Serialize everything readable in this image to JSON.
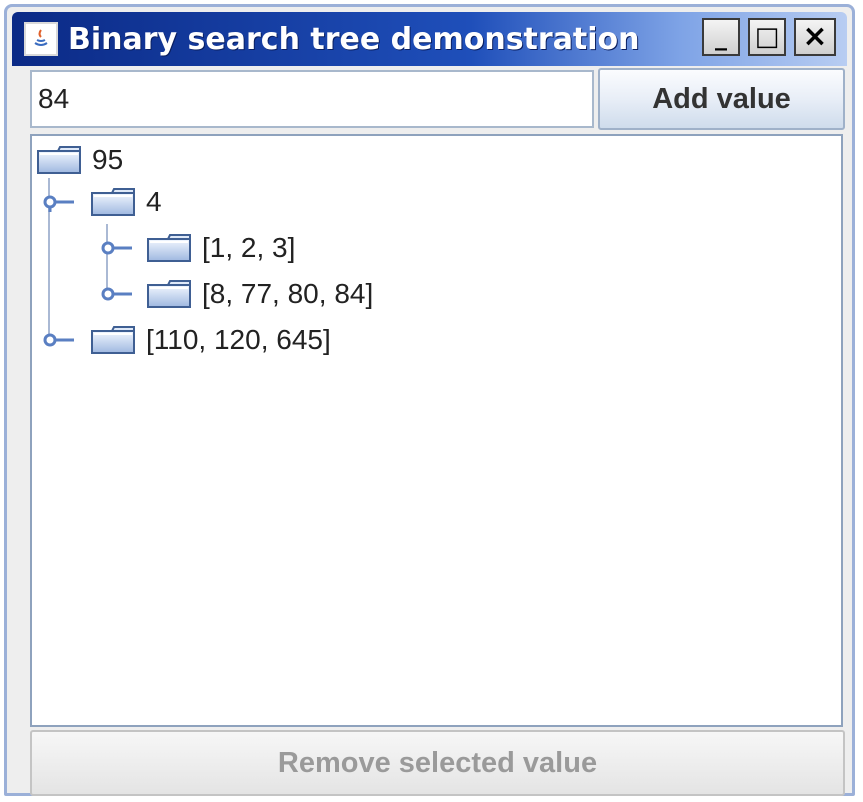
{
  "window": {
    "title": "Binary search tree demonstration",
    "controls": {
      "minimize": "_",
      "maximize": "□",
      "close": "×"
    },
    "titlebar_colors": [
      "#0b2a86",
      "#1f4fba",
      "#b8cdf2"
    ]
  },
  "input": {
    "value": "84"
  },
  "add_button": {
    "label": "Add value"
  },
  "tree": {
    "nodes": [
      {
        "label": "95",
        "level": 0,
        "icon": "folder-icon"
      },
      {
        "label": "4",
        "level": 1,
        "icon": "folder-icon",
        "handle": "expanded"
      },
      {
        "label": "[1, 2, 3]",
        "level": 2,
        "icon": "folder-icon",
        "handle": "collapsed"
      },
      {
        "label": "[8, 77, 80, 84]",
        "level": 2,
        "icon": "folder-icon",
        "handle": "collapsed"
      },
      {
        "label": "[110, 120, 645]",
        "level": 1,
        "icon": "folder-icon",
        "handle": "collapsed"
      }
    ]
  },
  "remove_button": {
    "label": "Remove selected value",
    "enabled": false
  },
  "colors": {
    "accent": "#1f4fba",
    "tree_line": "#aab9d4",
    "handle": "#5a7fc2"
  }
}
